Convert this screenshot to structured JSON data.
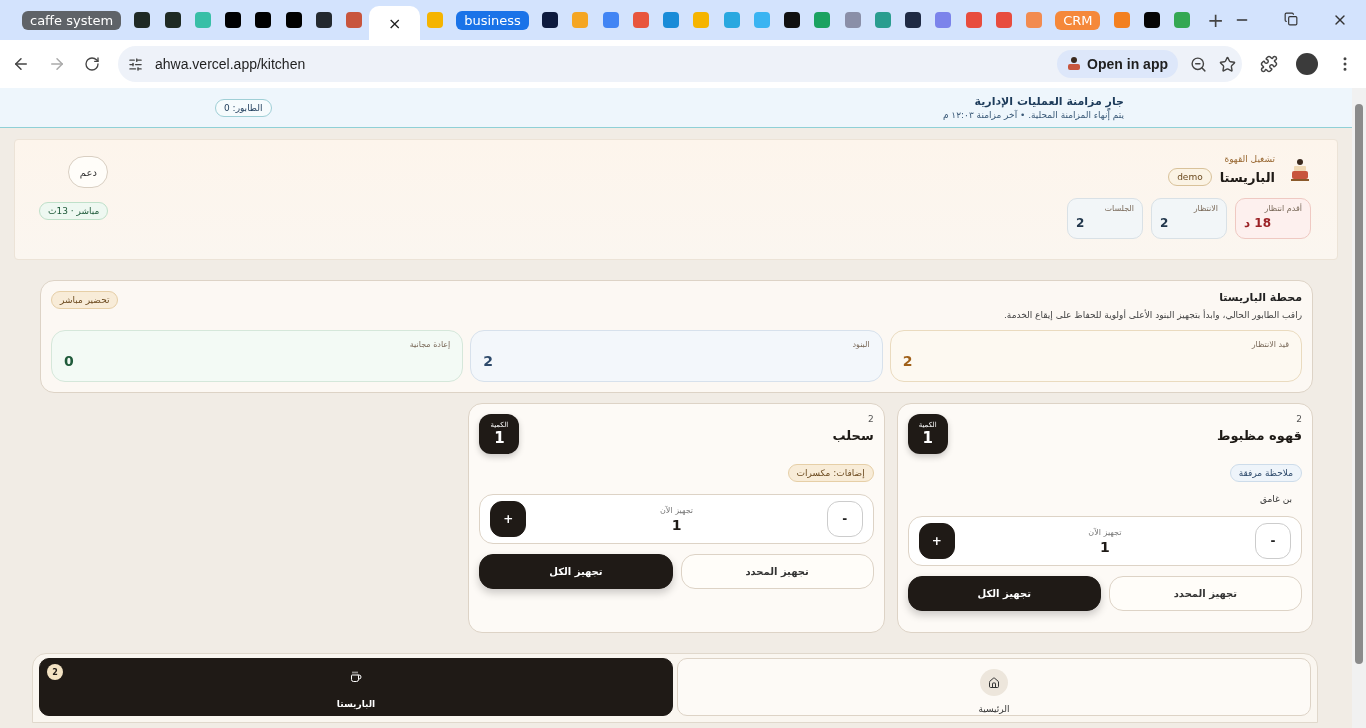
{
  "browser": {
    "tabs_rtl_order": [
      {
        "kind": "favicon",
        "color": "#34a853"
      },
      {
        "kind": "favicon",
        "color": "#050505"
      },
      {
        "kind": "favicon",
        "color": "#f38020"
      },
      {
        "kind": "group",
        "label": "CRM",
        "color": "#f5883a"
      },
      {
        "kind": "favicon",
        "color": "#f28b50"
      },
      {
        "kind": "favicon",
        "color": "#e84c3e"
      },
      {
        "kind": "favicon",
        "color": "#e84c3d"
      },
      {
        "kind": "favicon",
        "color": "#7b83eb"
      },
      {
        "kind": "favicon",
        "color": "#1f2a44"
      },
      {
        "kind": "favicon",
        "color": "#2a9d8f"
      },
      {
        "kind": "favicon",
        "color": "#8a8fa8"
      },
      {
        "kind": "favicon",
        "color": "#1aa260"
      },
      {
        "kind": "favicon",
        "color": "#111111"
      },
      {
        "kind": "favicon",
        "color": "#3ab4f2"
      },
      {
        "kind": "favicon",
        "color": "#29a8e0"
      },
      {
        "kind": "favicon",
        "color": "#f5b401"
      },
      {
        "kind": "favicon",
        "color": "#1a8cd8"
      },
      {
        "kind": "favicon",
        "color": "#e8553d"
      },
      {
        "kind": "favicon",
        "color": "#4285f4"
      },
      {
        "kind": "favicon",
        "color": "#f5a623"
      },
      {
        "kind": "favicon",
        "color": "#0d1b3e"
      },
      {
        "kind": "group",
        "label": "business",
        "color": "#1a73e8"
      },
      {
        "kind": "favicon",
        "color": "#f5b400"
      },
      {
        "kind": "active",
        "close": "×"
      },
      {
        "kind": "favicon",
        "color": "#c8553d"
      },
      {
        "kind": "favicon",
        "color": "#24292f"
      },
      {
        "kind": "favicon",
        "color": "#000000"
      },
      {
        "kind": "favicon",
        "color": "#000001"
      },
      {
        "kind": "favicon",
        "color": "#000002"
      },
      {
        "kind": "favicon",
        "color": "#38bfa7"
      },
      {
        "kind": "favicon",
        "color": "#1f2a24"
      },
      {
        "kind": "favicon",
        "color": "#1f2a25"
      },
      {
        "kind": "group",
        "label": "caffe system",
        "color": "#5f6368"
      }
    ],
    "new_tab": "+",
    "url": "ahwa.vercel.app/kitchen",
    "open_in_app": "Open in app"
  },
  "sync": {
    "title": "جارٍ مزامنة العمليات الإدارية",
    "subtitle": "يتم إنهاء المزامنة المحلية. • آخر مزامنة ١٢:٠٣ م",
    "queue": "الطابور: 0"
  },
  "header": {
    "eyebrow": "تشغيل القهوة",
    "title": "الباريستا",
    "badge": "demo",
    "support": "دعم",
    "live": "مباشر · 13ث",
    "stats": [
      {
        "label": "أقدم انتظار",
        "value": "18 د",
        "kind": "alert"
      },
      {
        "label": "الانتظار",
        "value": "2",
        "kind": "info"
      },
      {
        "label": "الجلسات",
        "value": "2",
        "kind": "info"
      }
    ]
  },
  "station": {
    "title": "محطة الباريستا",
    "description": "راقب الطابور الحالي، وابدأ بتجهيز البنود الأعلى أولوية للحفاظ على إيقاع الخدمة.",
    "mode": "تحضير مباشر",
    "stats": [
      {
        "label": "قيد الانتظار",
        "value": "2",
        "kind": "amber"
      },
      {
        "label": "البنود",
        "value": "2",
        "kind": "blue"
      },
      {
        "label": "إعادة مجانية",
        "value": "0",
        "kind": "green"
      }
    ]
  },
  "items": [
    {
      "number": "2",
      "name": "قهوه مظبوط",
      "qty_label": "الكمية",
      "qty": "1",
      "chips": [
        {
          "kind": "note",
          "text": "ملاحظة مرفقة"
        }
      ],
      "note": "بن غامق",
      "stepper_label": "تجهيز الآن",
      "stepper_value": "1",
      "minus": "-",
      "plus": "+",
      "prepare_selected": "تجهيز المحدد",
      "prepare_all": "تجهيز الكل"
    },
    {
      "number": "2",
      "name": "سحلب",
      "qty_label": "الكمية",
      "qty": "1",
      "chips": [
        {
          "kind": "addon",
          "text": "إضافات: مكسرات"
        }
      ],
      "stepper_label": "تجهيز الآن",
      "stepper_value": "1",
      "minus": "-",
      "plus": "+",
      "prepare_selected": "تجهيز المحدد",
      "prepare_all": "تجهيز الكل"
    }
  ],
  "nav": [
    {
      "label": "الرئيسية",
      "kind": "home",
      "selected": false
    },
    {
      "label": "الباريستا",
      "kind": "station",
      "selected": true,
      "badge": "2"
    }
  ]
}
